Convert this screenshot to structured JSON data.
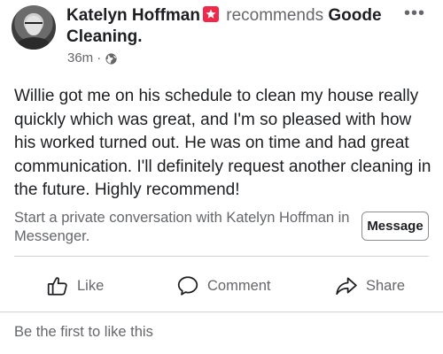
{
  "header": {
    "author": "Katelyn Hoffman",
    "recommends_text": "recommends",
    "page_name_part1": "Goode",
    "page_name_part2": "Cleaning",
    "page_name_punct": ".",
    "timestamp": "36m",
    "separator": "·",
    "privacy_icon": "globe-icon",
    "badge_icon": "recommendation-star-icon",
    "badge_color": "#f02849",
    "more_label": "•••"
  },
  "post": {
    "body": "Willie got me on his schedule to clean my house really quickly which was great, and I'm so pleased with how his worked turned out. He was on time and had great communication. I'll definitely request another cleaning in the future. Highly recommend!"
  },
  "messenger": {
    "prompt": "Start a private conversation with Katelyn Hoffman in Messenger.",
    "button_label": "Message"
  },
  "actions": {
    "like_label": "Like",
    "comment_label": "Comment",
    "share_label": "Share"
  },
  "footer": {
    "likes_text": "Be the first to like this"
  },
  "colors": {
    "text_primary": "#1c1e21",
    "text_secondary": "#65676b",
    "divider": "#d0d2d6"
  }
}
